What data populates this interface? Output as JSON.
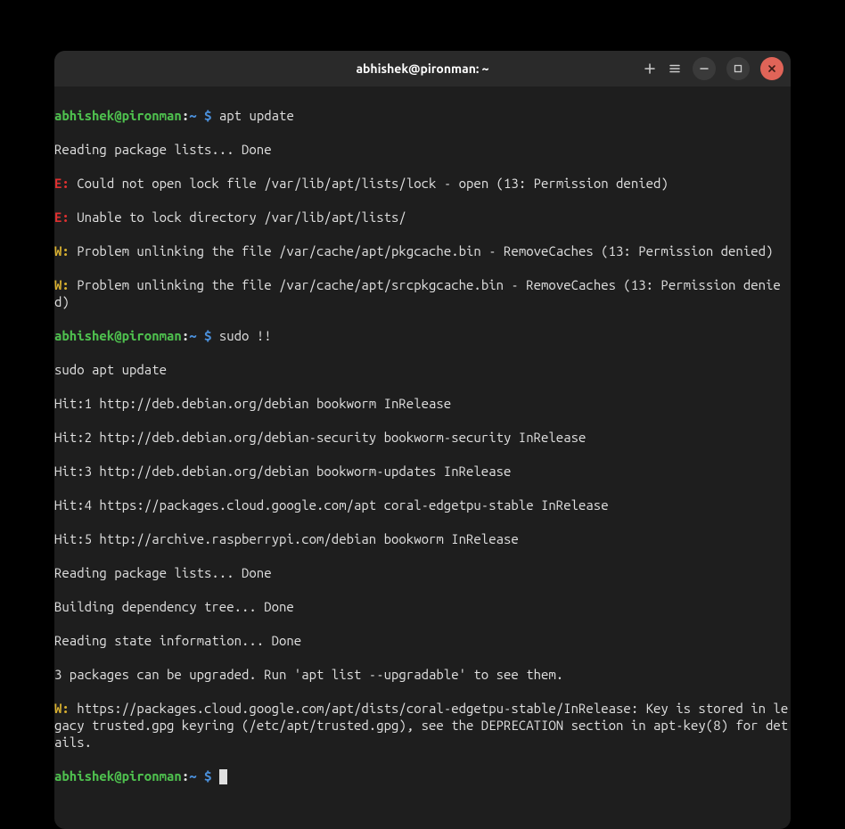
{
  "window": {
    "title": "abhishek@pironman: ~"
  },
  "prompt": {
    "user": "abhishek",
    "host": "pironman",
    "path": "~",
    "symbol": "$"
  },
  "lines": {
    "cmd1": "apt update",
    "out1": "Reading package lists... Done",
    "e1_prefix": "E:",
    "e1_text": " Could not open lock file /var/lib/apt/lists/lock - open (13: Permission denied)",
    "e2_prefix": "E:",
    "e2_text": " Unable to lock directory /var/lib/apt/lists/",
    "w1_prefix": "W:",
    "w1_text": " Problem unlinking the file /var/cache/apt/pkgcache.bin - RemoveCaches (13: Permission denied)",
    "w2_prefix": "W:",
    "w2_text": " Problem unlinking the file /var/cache/apt/srcpkgcache.bin - RemoveCaches (13: Permission denied)",
    "cmd2": "sudo !!",
    "out2": "sudo apt update",
    "hit1": "Hit:1 http://deb.debian.org/debian bookworm InRelease",
    "hit2": "Hit:2 http://deb.debian.org/debian-security bookworm-security InRelease",
    "hit3": "Hit:3 http://deb.debian.org/debian bookworm-updates InRelease",
    "hit4": "Hit:4 https://packages.cloud.google.com/apt coral-edgetpu-stable InRelease",
    "hit5": "Hit:5 http://archive.raspberrypi.com/debian bookworm InRelease",
    "out3": "Reading package lists... Done",
    "out4": "Building dependency tree... Done",
    "out5": "Reading state information... Done",
    "out6": "3 packages can be upgraded. Run 'apt list --upgradable' to see them.",
    "w3_prefix": "W:",
    "w3_text": " https://packages.cloud.google.com/apt/dists/coral-edgetpu-stable/InRelease: Key is stored in legacy trusted.gpg keyring (/etc/apt/trusted.gpg), see the DEPRECATION section in apt-key(8) for details."
  }
}
